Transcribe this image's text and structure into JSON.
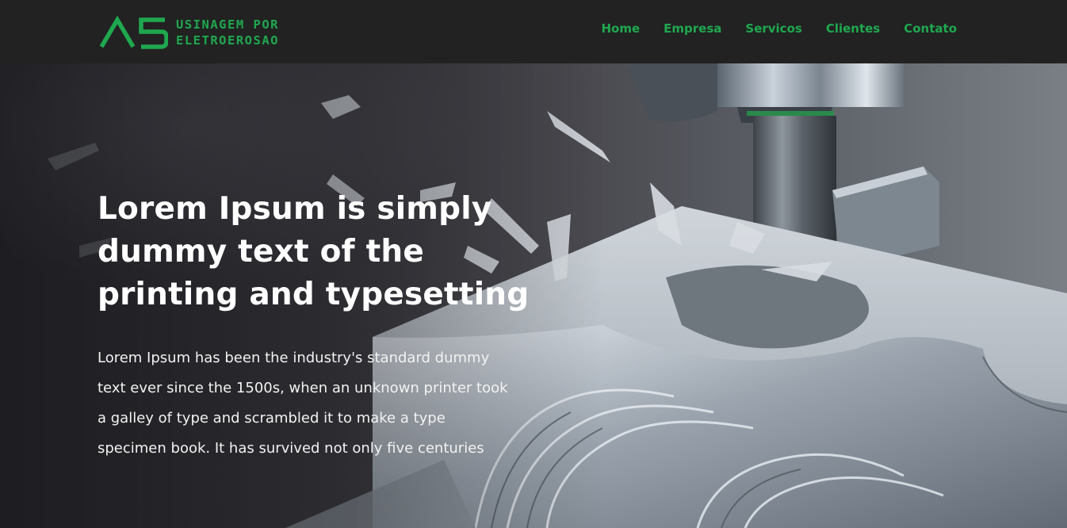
{
  "brand": {
    "logo_mark": "A5",
    "logo_line1": "USINAGEM POR",
    "logo_line2": "ELETROEROSAO",
    "accent_color": "#1fa84f"
  },
  "nav": {
    "items": [
      {
        "label": "Home"
      },
      {
        "label": "Empresa"
      },
      {
        "label": "Servicos"
      },
      {
        "label": "Clientes"
      },
      {
        "label": "Contato"
      }
    ]
  },
  "hero": {
    "title_line1": "Lorem Ipsum is simply",
    "title_line2": "dummy text of the",
    "title_line3": "printing and typesetting",
    "text_line1": "Lorem Ipsum has been the industry's standard dummy",
    "text_line2": "text ever since the 1500s, when an unknown printer took",
    "text_line3": "a galley of type and scrambled it to make a type",
    "text_line4": "specimen book. It has survived not only five centuries",
    "background": "cnc-milling-machine-image"
  }
}
